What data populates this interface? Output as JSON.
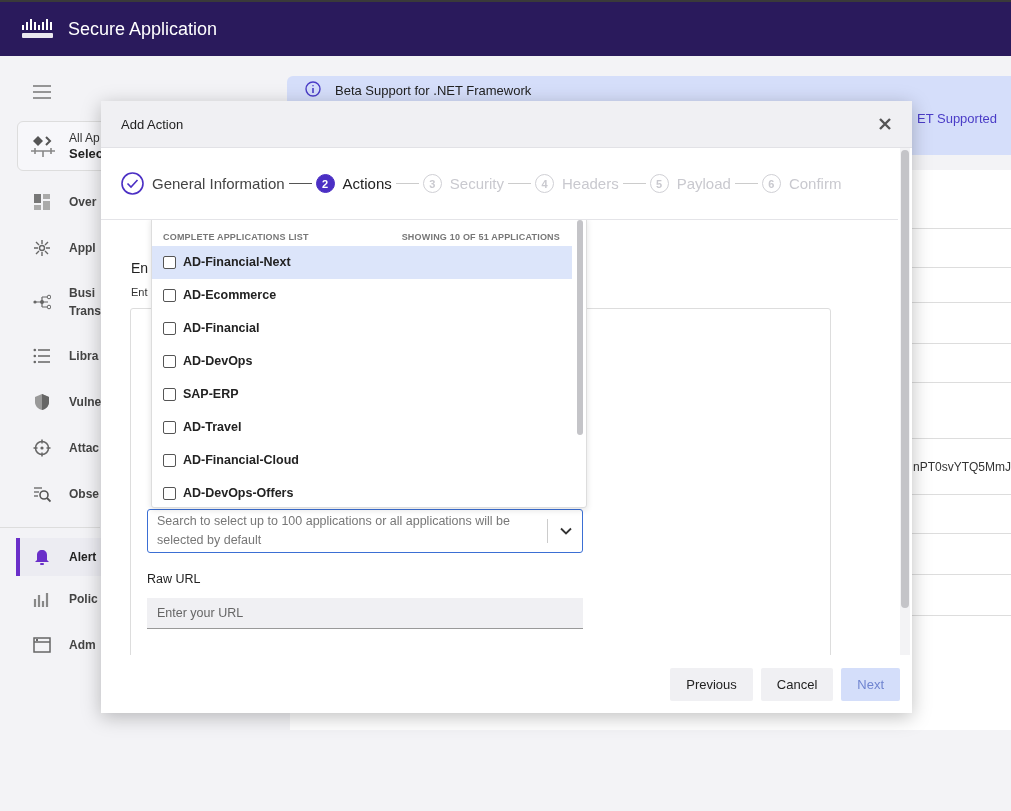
{
  "app_header": {
    "title": "Secure Application"
  },
  "sidebar": {
    "app_selector": {
      "label": "All Ap",
      "value": "Selec"
    },
    "items": [
      {
        "label": "Over",
        "selected": false
      },
      {
        "label": "Appl",
        "selected": false
      },
      {
        "label": "Busi\nTrans",
        "selected": false
      },
      {
        "label": "Libra",
        "selected": false
      },
      {
        "label": "Vulne",
        "selected": false
      },
      {
        "label": "Attac",
        "selected": false
      },
      {
        "label": "Obse",
        "selected": false
      },
      {
        "label": "Alert",
        "selected": true
      },
      {
        "label": "Polic",
        "selected": false
      },
      {
        "label": "Adm",
        "selected": false
      }
    ]
  },
  "banner": {
    "text": "Beta Support for .NET Framework",
    "link": "ET Supported"
  },
  "background_table": {
    "visible_cell": "nPT0svYTQ5MmJ"
  },
  "modal": {
    "title": "Add Action",
    "steps": [
      {
        "label": "General Information",
        "completed": true,
        "selected": false
      },
      {
        "number": "2",
        "label": "Actions",
        "completed": false,
        "selected": true
      },
      {
        "number": "3",
        "label": "Security",
        "completed": false,
        "selected": false
      },
      {
        "number": "4",
        "label": "Headers",
        "completed": false,
        "selected": false
      },
      {
        "number": "5",
        "label": "Payload",
        "completed": false,
        "selected": false
      },
      {
        "number": "6",
        "label": "Confirm",
        "completed": false,
        "selected": false
      }
    ],
    "section_heading": "En",
    "section_text": "Ent",
    "applications_dropdown": {
      "header": "COMPLETE APPLICATIONS LIST",
      "count": "SHOWING 10 OF 51 APPLICATIONS",
      "options": [
        {
          "label": "AD-Financial-Next",
          "checked": false,
          "selected": true
        },
        {
          "label": "AD-Ecommerce",
          "checked": false,
          "selected": false
        },
        {
          "label": "AD-Financial",
          "checked": false,
          "selected": false
        },
        {
          "label": "AD-DevOps",
          "checked": false,
          "selected": false
        },
        {
          "label": "SAP-ERP",
          "checked": false,
          "selected": false
        },
        {
          "label": "AD-Travel",
          "checked": false,
          "selected": false
        },
        {
          "label": "AD-Financial-Cloud",
          "checked": false,
          "selected": false
        },
        {
          "label": "AD-DevOps-Offers",
          "checked": false,
          "selected": false
        }
      ]
    },
    "applications_field": {
      "placeholder": "Search to select up to 100 applications or all applications will be selected by default"
    },
    "raw_url": {
      "label": "Raw URL",
      "placeholder": "Enter your URL"
    },
    "buttons": [
      {
        "label": "Previous",
        "disabled": false,
        "kind": "secondary"
      },
      {
        "label": "Cancel",
        "disabled": false,
        "kind": "secondary"
      },
      {
        "label": "Next",
        "disabled": true,
        "kind": "primary"
      }
    ]
  }
}
